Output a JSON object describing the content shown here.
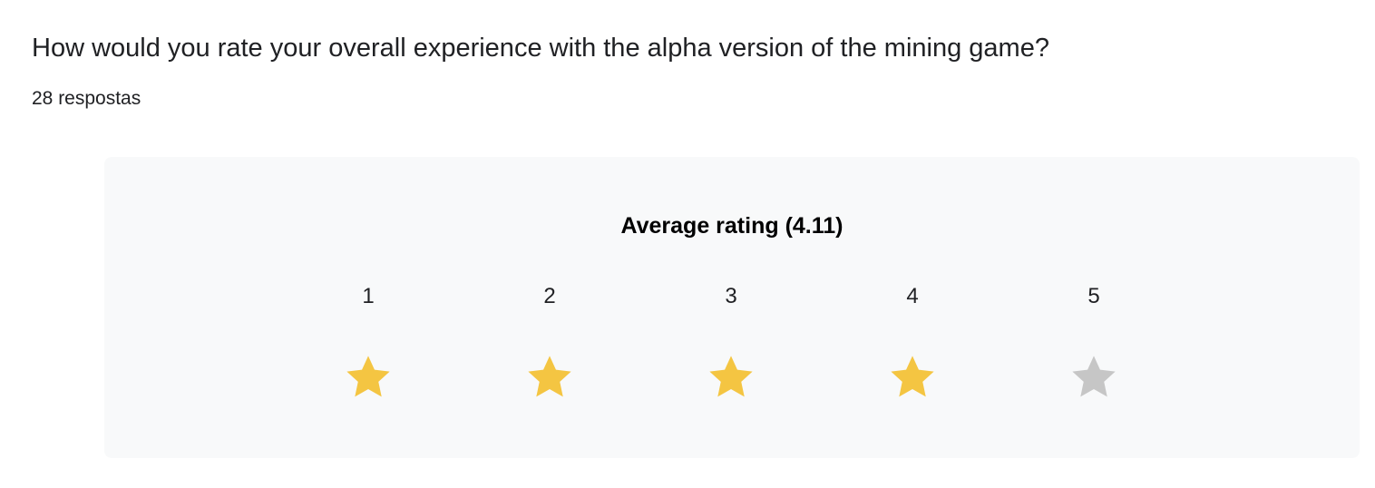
{
  "question": {
    "title": "How would you rate your overall experience with the alpha version of the mining game?",
    "response_count": "28 respostas"
  },
  "rating_summary": {
    "heading": "Average rating (4.11)",
    "average": 4.11,
    "max": 5,
    "filled_color": "#f4c542",
    "empty_color": "#c6c6c6",
    "scale": [
      {
        "label": "1",
        "icon": "star-icon",
        "filled": true
      },
      {
        "label": "2",
        "icon": "star-icon",
        "filled": true
      },
      {
        "label": "3",
        "icon": "star-icon",
        "filled": true
      },
      {
        "label": "4",
        "icon": "star-icon",
        "filled": true
      },
      {
        "label": "5",
        "icon": "star-icon",
        "filled": false
      }
    ]
  }
}
